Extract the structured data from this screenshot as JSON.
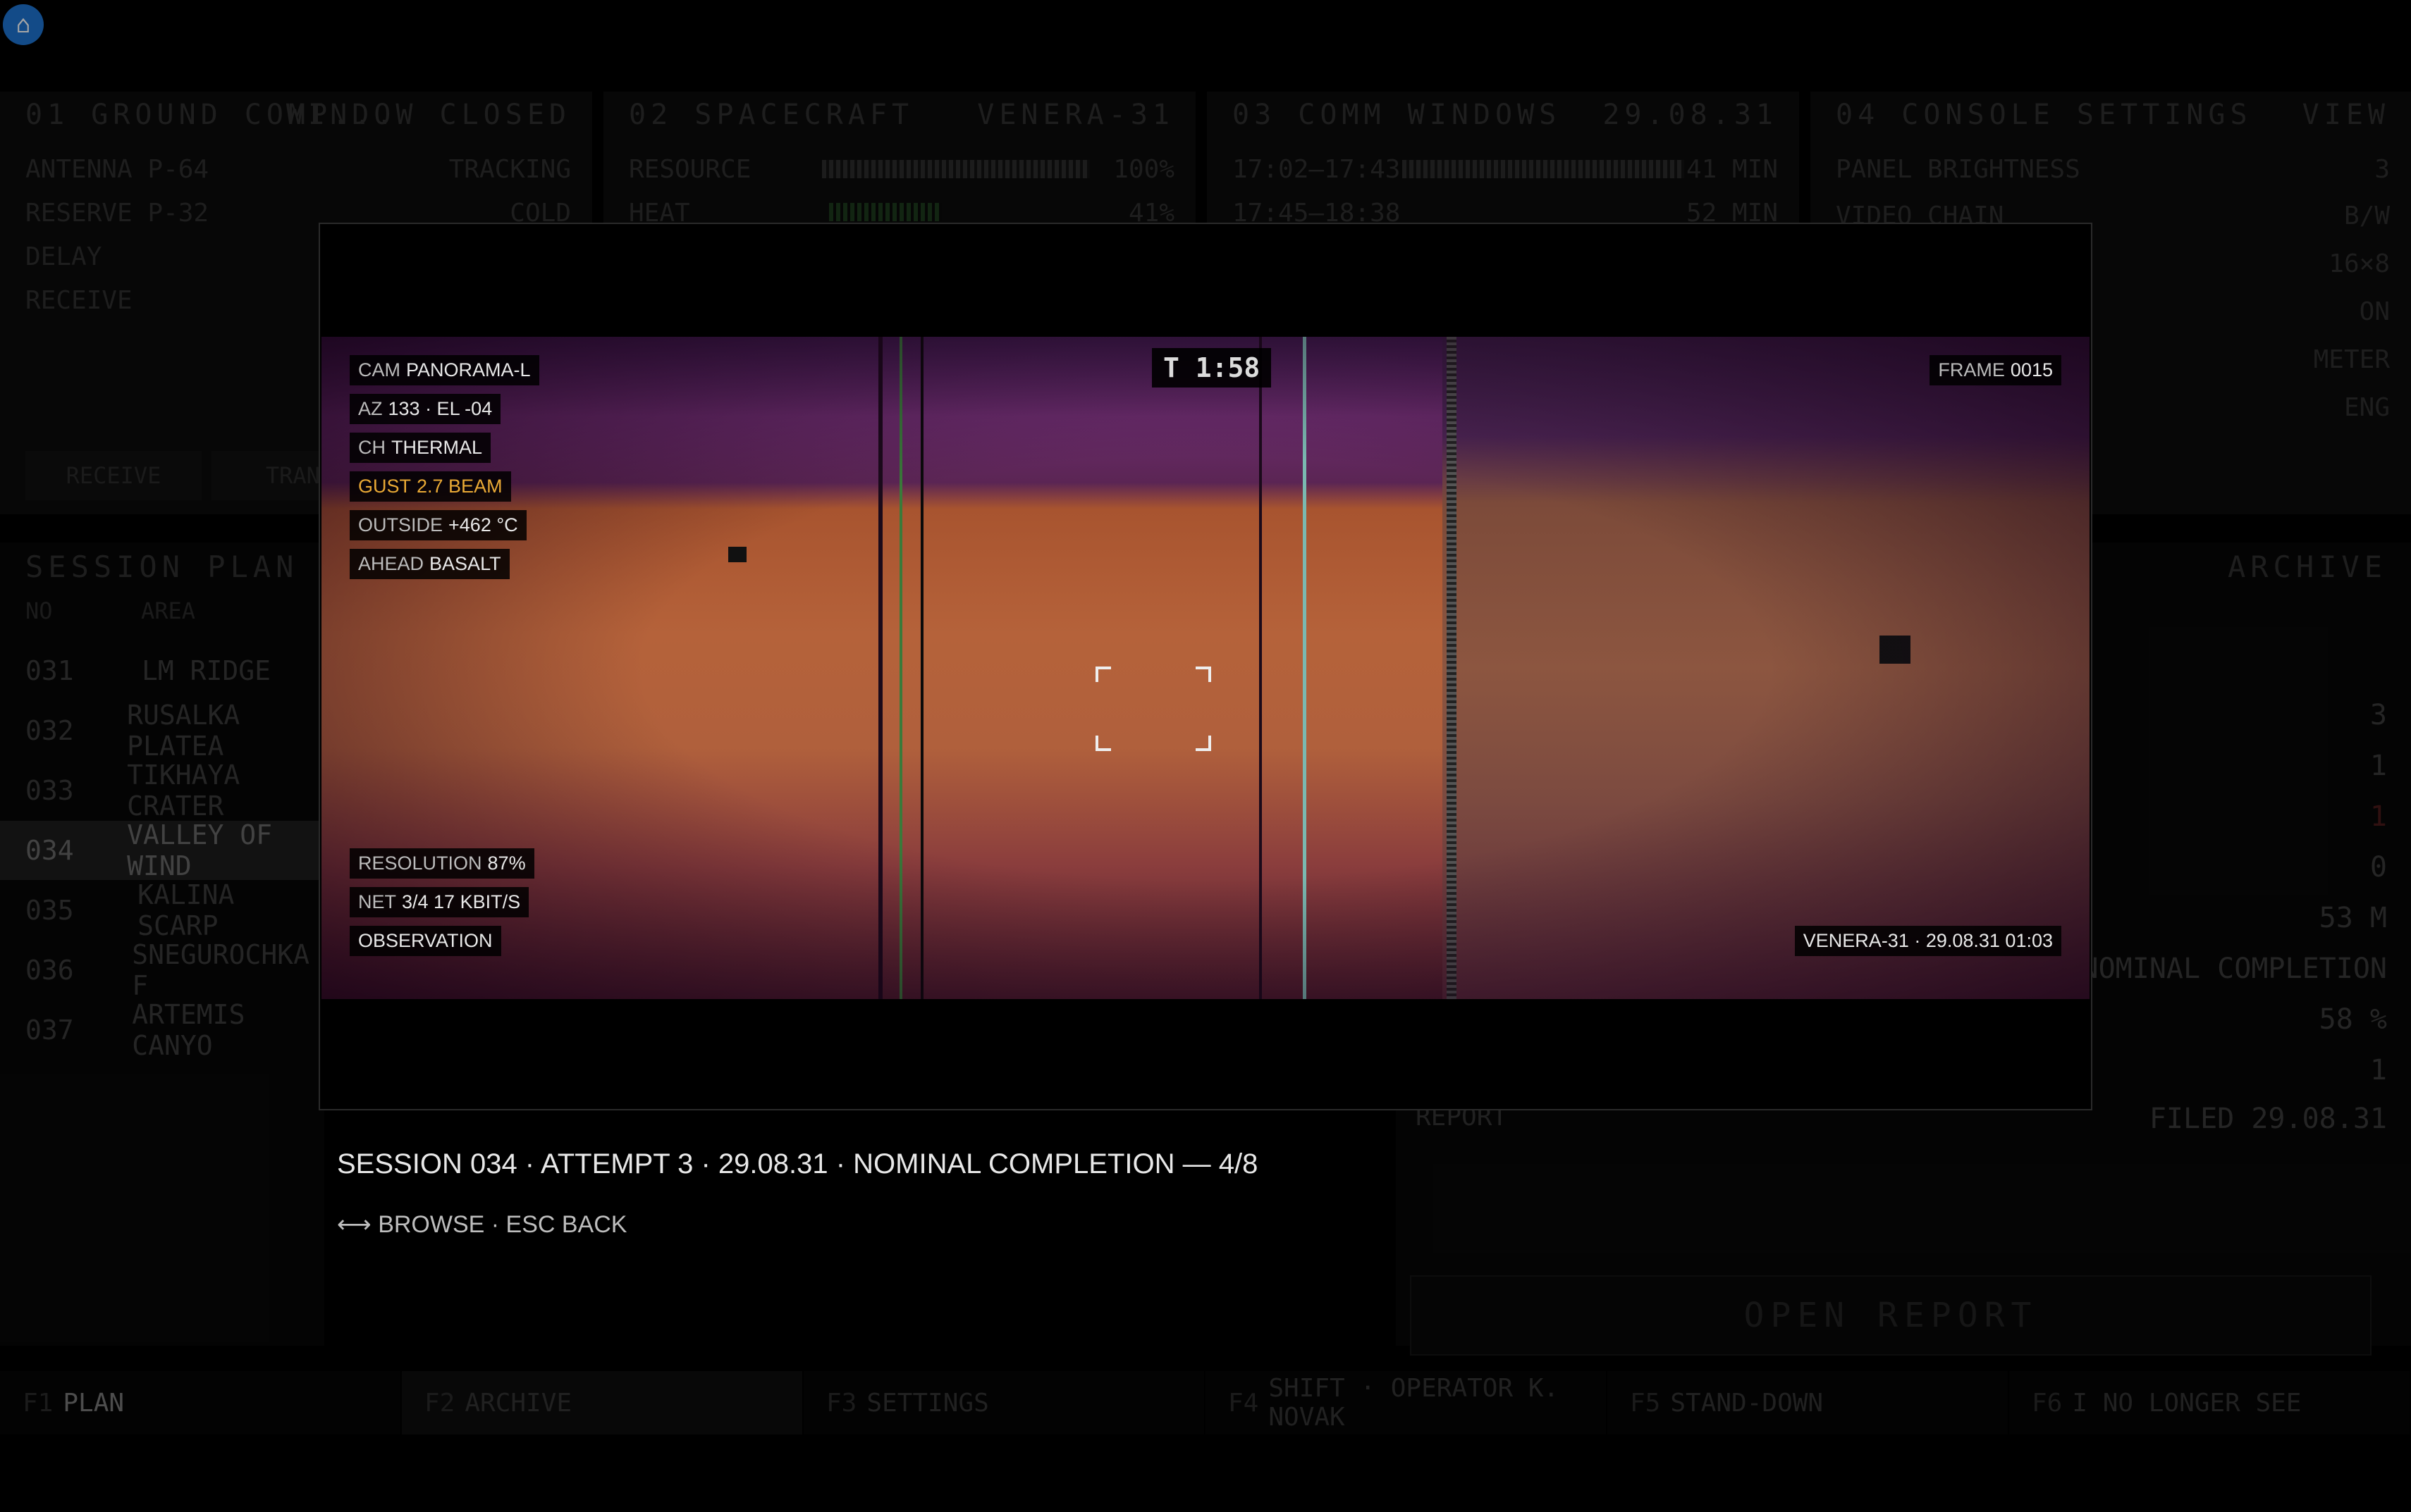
{
  "panels": {
    "ground": {
      "title": "01 GROUND COMP...",
      "status": "WINDOW CLOSED",
      "rows": [
        {
          "label": "ANTENNA P-64",
          "value": "TRACKING"
        },
        {
          "label": "RESERVE P-32",
          "value": "COLD"
        },
        {
          "label": "DELAY",
          "value": ""
        },
        {
          "label": "RECEIVE",
          "value": ""
        }
      ],
      "buttons": [
        "RECEIVE",
        "TRANS"
      ]
    },
    "spacecraft": {
      "title": "02 SPACECRAFT",
      "name": "VENERA-31",
      "rows": [
        {
          "label": "RESOURCE",
          "value": "100%",
          "level": 1.0
        },
        {
          "label": "HEAT",
          "value": "41%",
          "level": 0.41
        }
      ]
    },
    "comm": {
      "title": "03 COMM WINDOWS",
      "date": "29.08.31",
      "rows": [
        {
          "label": "17:02–17:43",
          "value": "41 MIN"
        },
        {
          "label": "17:45–18:38",
          "value": "52 MIN"
        }
      ]
    },
    "console": {
      "title": "04 CONSOLE SETTINGS",
      "view": "VIEW",
      "rows": [
        {
          "label": "PANEL BRIGHTNESS",
          "value": "3"
        },
        {
          "label": "VIDEO CHAIN",
          "value": "B/W"
        },
        {
          "label": "",
          "value": "16×8"
        },
        {
          "label": "",
          "value": "ON"
        },
        {
          "label": "",
          "value": "METER"
        },
        {
          "label": "",
          "value": "ENG"
        }
      ]
    }
  },
  "session_plan": {
    "title": "SESSION PLAN",
    "headers": {
      "no": "NO",
      "area": "AREA"
    },
    "rows": [
      {
        "no": "031",
        "area": "LM RIDGE"
      },
      {
        "no": "032",
        "area": "RUSALKA PLATEA"
      },
      {
        "no": "033",
        "area": "TIKHAYA CRATER"
      },
      {
        "no": "034",
        "area": "VALLEY OF WIND"
      },
      {
        "no": "035",
        "area": "KALINA SCARP"
      },
      {
        "no": "036",
        "area": "SNEGUROCHKA F"
      },
      {
        "no": "037",
        "area": "ARTEMIS CANYO"
      }
    ],
    "selected_index": 3
  },
  "archive": {
    "title": "ARCHIVE",
    "values": [
      "3",
      "1",
      "1",
      "0",
      "53 M",
      "NOMINAL COMPLETION",
      "58 %",
      "1"
    ],
    "report_label": "REPORT",
    "report_value": "FILED 29.08.31",
    "open_button": "OPEN REPORT"
  },
  "footer": [
    {
      "key": "F1",
      "label": "PLAN"
    },
    {
      "key": "F2",
      "label": "ARCHIVE"
    },
    {
      "key": "F3",
      "label": "SETTINGS"
    },
    {
      "key": "F4",
      "label": "SHIFT · OPERATOR K. NOVAK"
    },
    {
      "key": "F5",
      "label": "STAND-DOWN"
    },
    {
      "key": "F6",
      "label": "I NO LONGER SEE"
    }
  ],
  "viewer": {
    "overlay_left": [
      {
        "k": "CAM",
        "v": "PANORAMA-L"
      },
      {
        "k": "AZ",
        "v": "133 · EL -04"
      },
      {
        "k": "CH",
        "v": "THERMAL"
      },
      {
        "k": "GUST",
        "v": "2.7 BEAM",
        "amber": true
      },
      {
        "k": "OUTSIDE",
        "v": "+462 °C"
      },
      {
        "k": "AHEAD",
        "v": "BASALT"
      }
    ],
    "overlay_bottom": [
      {
        "k": "RESOLUTION",
        "v": "87%"
      },
      {
        "k": "NET",
        "v": "3/4  17 KBIT/S"
      },
      {
        "k": "",
        "v": "OBSERVATION"
      }
    ],
    "timer": "T 1:58",
    "frame_label": "FRAME",
    "frame_value": "0015",
    "stamp": "VENERA-31 · 29.08.31 01:03",
    "caption": "SESSION 034 · ATTEMPT 3 · 29.08.31 · NOMINAL COMPLETION — 4/8",
    "hint": "⟷ BROWSE · ESC BACK"
  },
  "colors": {
    "accent": "#1e74d2",
    "amber": "#e9a935",
    "thermal_orange": "#b5623a",
    "thermal_purple": "#6a2c6c"
  }
}
